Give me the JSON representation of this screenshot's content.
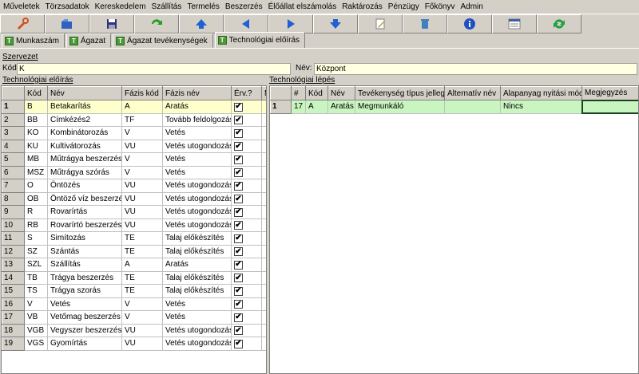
{
  "menu": [
    "Műveletek",
    "Törzsadatok",
    "Kereskedelem",
    "Szállítás",
    "Termelés",
    "Beszerzés",
    "Élőállat elszámolás",
    "Raktározás",
    "Pénzügy",
    "Főkönyv",
    "Admin"
  ],
  "toolbar": [
    {
      "name": "tools-icon",
      "color": "#d05020"
    },
    {
      "name": "open-icon",
      "color": "#3060c0"
    },
    {
      "name": "save-icon",
      "color": "#303080"
    },
    {
      "name": "refresh-green-icon",
      "color": "#20a020"
    },
    {
      "name": "up-icon",
      "color": "#2060d0"
    },
    {
      "name": "left-arrow-icon",
      "color": "#2060d0"
    },
    {
      "name": "right-arrow-icon",
      "color": "#2060d0"
    },
    {
      "name": "down-icon",
      "color": "#2060d0"
    },
    {
      "name": "edit-icon",
      "color": "#c0a030"
    },
    {
      "name": "trash-icon",
      "color": "#4080c0"
    },
    {
      "name": "info-icon",
      "color": "#2050c0"
    },
    {
      "name": "window-icon",
      "color": "#808080"
    },
    {
      "name": "reload-icon",
      "color": "#20a040"
    }
  ],
  "tabs": [
    {
      "label": "Munkaszám",
      "active": false
    },
    {
      "label": "Ágazat",
      "active": false
    },
    {
      "label": "Ágazat tevékenységek",
      "active": false
    },
    {
      "label": "Technológiai előírás",
      "active": true
    }
  ],
  "tab_icon_letter": "T",
  "szervezet": {
    "title": "Szervezet",
    "kod_label": "Kód",
    "kod_value": "K",
    "nev_label": "Név:",
    "nev_value": "Központ"
  },
  "left_grid": {
    "title": "Technológiai előírás",
    "columns": [
      "Kód",
      "Név",
      "Fázis kód",
      "Fázis név",
      "Érv.?",
      "M"
    ],
    "rows": [
      {
        "n": "1",
        "kod": "B",
        "nev": "Betakarítás",
        "fkod": "A",
        "fnev": "Aratás",
        "erv": true
      },
      {
        "n": "2",
        "kod": "BB",
        "nev": "Címkézés2",
        "fkod": "TF",
        "fnev": "Tovább feldolgozás",
        "erv": true
      },
      {
        "n": "3",
        "kod": "KO",
        "nev": "Kombinátorozás",
        "fkod": "V",
        "fnev": "Vetés",
        "erv": true
      },
      {
        "n": "4",
        "kod": "KU",
        "nev": "Kultivátorozás",
        "fkod": "VU",
        "fnev": "Vetés utogondozás",
        "erv": true
      },
      {
        "n": "5",
        "kod": "MB",
        "nev": "Műtrágya beszerzés",
        "fkod": "V",
        "fnev": "Vetés",
        "erv": true
      },
      {
        "n": "6",
        "kod": "MSZ",
        "nev": "Műtrágya szórás",
        "fkod": "V",
        "fnev": "Vetés",
        "erv": true
      },
      {
        "n": "7",
        "kod": "O",
        "nev": "Öntözés",
        "fkod": "VU",
        "fnev": "Vetés utogondozás",
        "erv": true
      },
      {
        "n": "8",
        "kod": "OB",
        "nev": "Öntöző víz beszerzés",
        "fkod": "VU",
        "fnev": "Vetés utogondozás",
        "erv": true
      },
      {
        "n": "9",
        "kod": "R",
        "nev": "Rovarírtás",
        "fkod": "VU",
        "fnev": "Vetés utogondozás",
        "erv": true
      },
      {
        "n": "10",
        "kod": "RB",
        "nev": "Rovarírtó beszerzés",
        "fkod": "VU",
        "fnev": "Vetés utogondozás",
        "erv": true
      },
      {
        "n": "11",
        "kod": "S",
        "nev": "Simítozás",
        "fkod": "TE",
        "fnev": "Talaj előkészítés",
        "erv": true
      },
      {
        "n": "12",
        "kod": "SZ",
        "nev": "Szántás",
        "fkod": "TE",
        "fnev": "Talaj előkészítés",
        "erv": true
      },
      {
        "n": "13",
        "kod": "SZL",
        "nev": "Szállítás",
        "fkod": "A",
        "fnev": "Aratás",
        "erv": true
      },
      {
        "n": "14",
        "kod": "TB",
        "nev": "Trágya beszerzés",
        "fkod": "TE",
        "fnev": "Talaj előkészítés",
        "erv": true
      },
      {
        "n": "15",
        "kod": "TS",
        "nev": "Trágya szorás",
        "fkod": "TE",
        "fnev": "Talaj előkészítés",
        "erv": true
      },
      {
        "n": "16",
        "kod": "V",
        "nev": "Vetés",
        "fkod": "V",
        "fnev": "Vetés",
        "erv": true
      },
      {
        "n": "17",
        "kod": "VB",
        "nev": "Vetőmag beszerzés",
        "fkod": "V",
        "fnev": "Vetés",
        "erv": true
      },
      {
        "n": "18",
        "kod": "VGB",
        "nev": "Vegyszer beszerzés",
        "fkod": "VU",
        "fnev": "Vetés utogondozás",
        "erv": true
      },
      {
        "n": "19",
        "kod": "VGS",
        "nev": "Gyomírtás",
        "fkod": "VU",
        "fnev": "Vetés utogondozás",
        "erv": true
      }
    ]
  },
  "right_grid": {
    "title": "Technológiai lépés",
    "columns": [
      "#",
      "Kód",
      "Név",
      "Tevékenység típus jelleg",
      "Alternatív név",
      "Alapanyag nyitási mód",
      "Megjegyzés"
    ],
    "rows": [
      {
        "n": "1",
        "num": "17",
        "kod": "A",
        "nev": "Aratás",
        "tipus": "Megmunkáló",
        "alt": "",
        "alap": "Nincs",
        "megj": ""
      }
    ]
  },
  "check_mark": "✔"
}
